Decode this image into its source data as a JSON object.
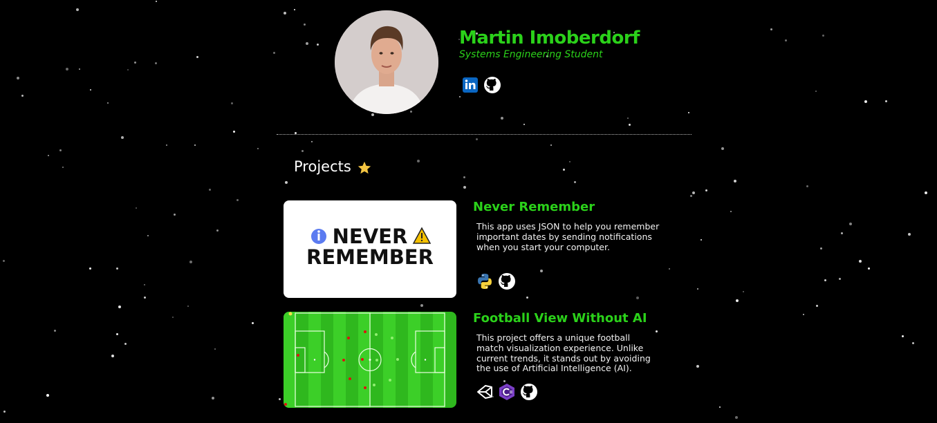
{
  "profile": {
    "name": "Martin Imoberdorf",
    "subtitle": "Systems Engineering Student"
  },
  "social_links": [
    {
      "icon": "linkedin-icon"
    },
    {
      "icon": "github-icon"
    }
  ],
  "projects_section": {
    "title": "Projects",
    "icon": "star-icon"
  },
  "projects": [
    {
      "title": "Never Remember",
      "description": "This app uses JSON to help you remember important dates by sending notifications when you start your computer.",
      "image_text_line1": "NEVER",
      "image_text_line2": "REMEMBER",
      "tech_icons": [
        "python-icon",
        "github-icon"
      ]
    },
    {
      "title": "Football View Without AI",
      "description": "This project offers a unique football match visualization experience. Unlike current trends, it stands out by avoiding the use of Artificial Intelligence (AI).",
      "tech_icons": [
        "unity-icon",
        "csharp-icon",
        "github-icon"
      ]
    }
  ],
  "colors": {
    "accent": "#2bd11a",
    "background": "#000000",
    "star": "#f4c542",
    "linkedin": "#0a66c2",
    "pitch_light": "#3ccf28",
    "pitch_dark": "#2fb81e"
  }
}
